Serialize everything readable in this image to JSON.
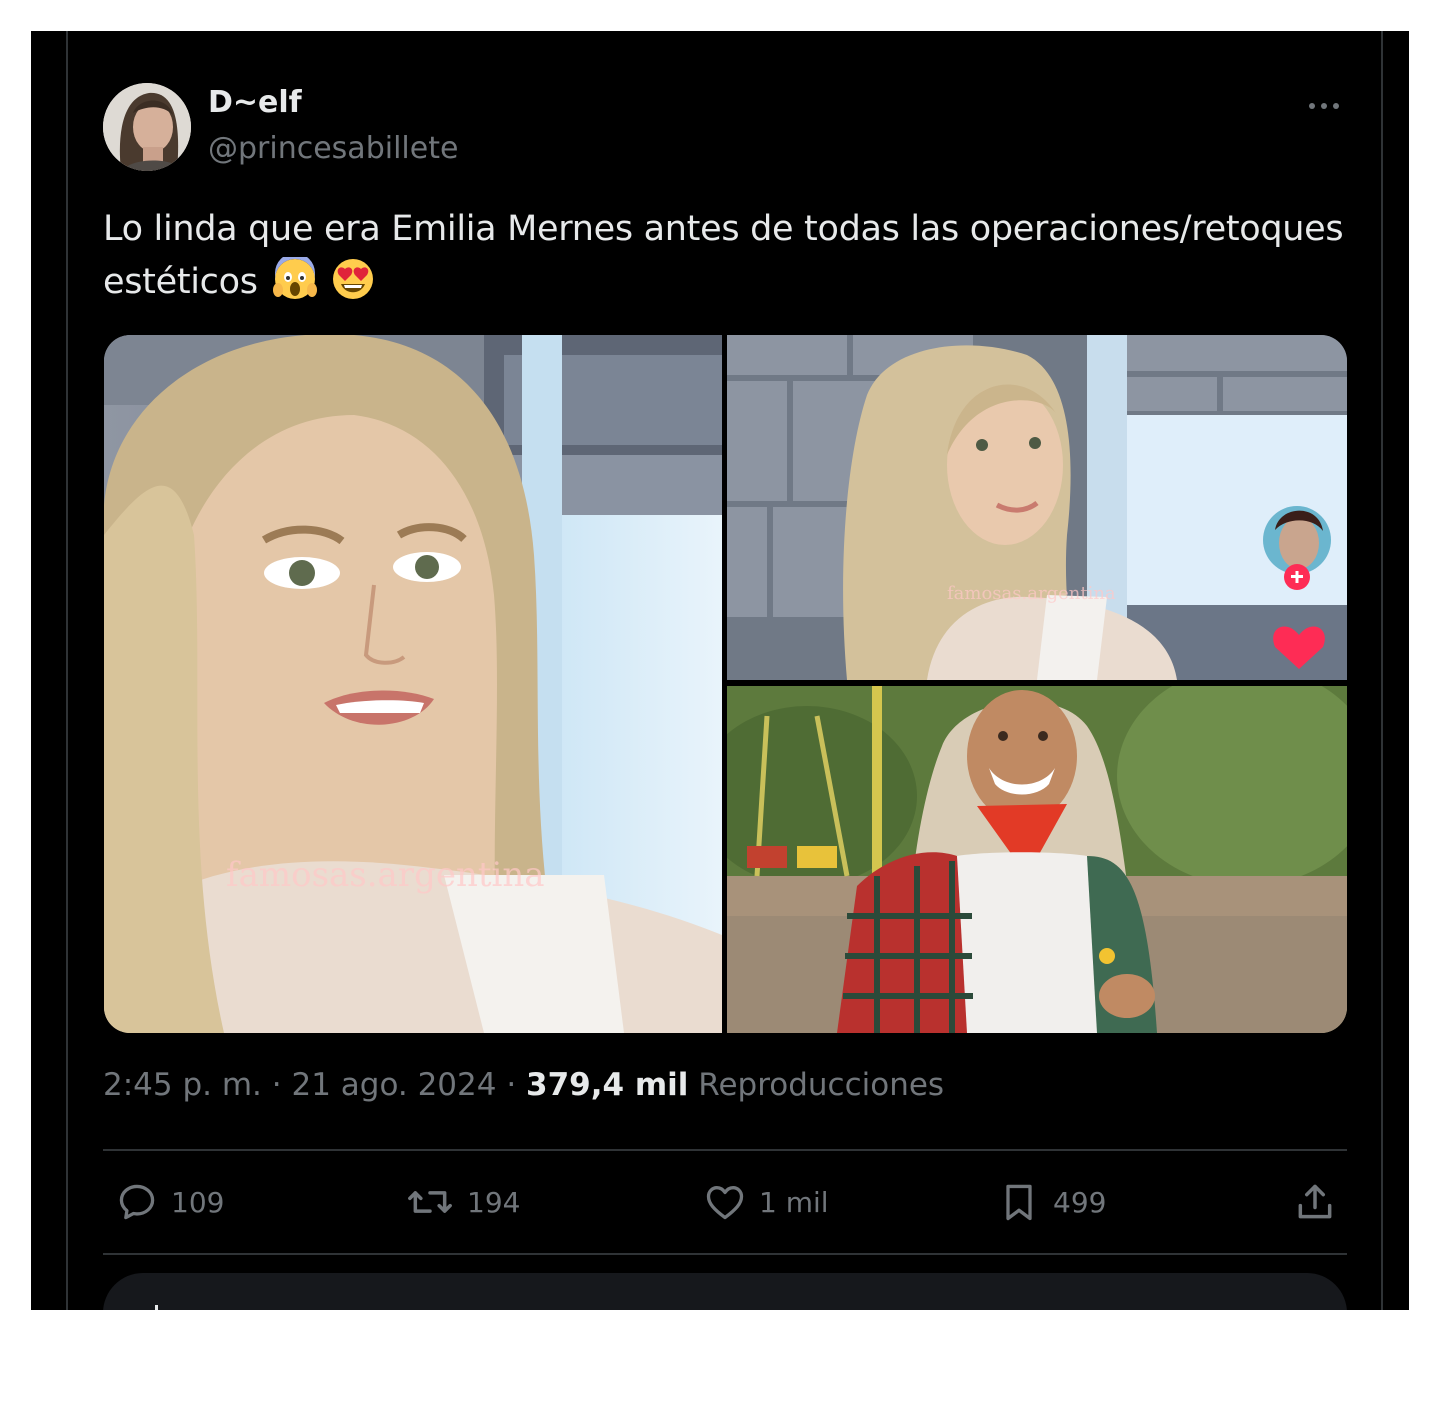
{
  "tweet": {
    "display_name": "D~elf",
    "handle": "@princesabillete",
    "text": "Lo linda que era Emilia Mernes antes de todas las operaciones/retoques estéticos",
    "emojis": [
      "face-screaming-in-fear",
      "smiling-face-with-heart-eyes"
    ],
    "time": "2:45 p. m. · 21 ago. 2024 · ",
    "views_count": "379,4 mil",
    "views_label": " Reproducciones",
    "watermark": "famosas.argentina"
  },
  "actions": {
    "replies": "109",
    "reposts": "194",
    "likes": "1 mil",
    "bookmarks": "499"
  },
  "colors": {
    "background": "#000000",
    "text_primary": "#e7e9ea",
    "text_secondary": "#71767b",
    "divider": "#2f3336"
  }
}
